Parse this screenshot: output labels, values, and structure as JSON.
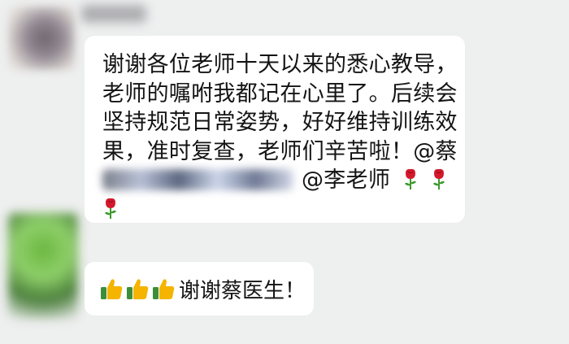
{
  "message": {
    "lines": [
      "谢谢各位老师十天以来的悉心教导，",
      "老师的嘱咐我都记在心里了。后续会",
      "坚持规范日常姿势，好好维持训练效",
      "果，准时复查，老师们辛苦啦！@蔡"
    ],
    "mention": "@李老师",
    "trailing_icons": [
      "rose-icon",
      "rose-icon",
      "rose-icon"
    ]
  },
  "reply": {
    "icons": [
      "thumbs-up-icon",
      "thumbs-up-icon",
      "thumbs-up-icon"
    ],
    "text": "谢谢蔡医生！"
  },
  "colors": {
    "background": "#eeefef",
    "bubble": "#ffffff",
    "text": "#141414",
    "rose": "#d4182b",
    "stem": "#3d9a2d",
    "thumb": "#f4b400"
  }
}
